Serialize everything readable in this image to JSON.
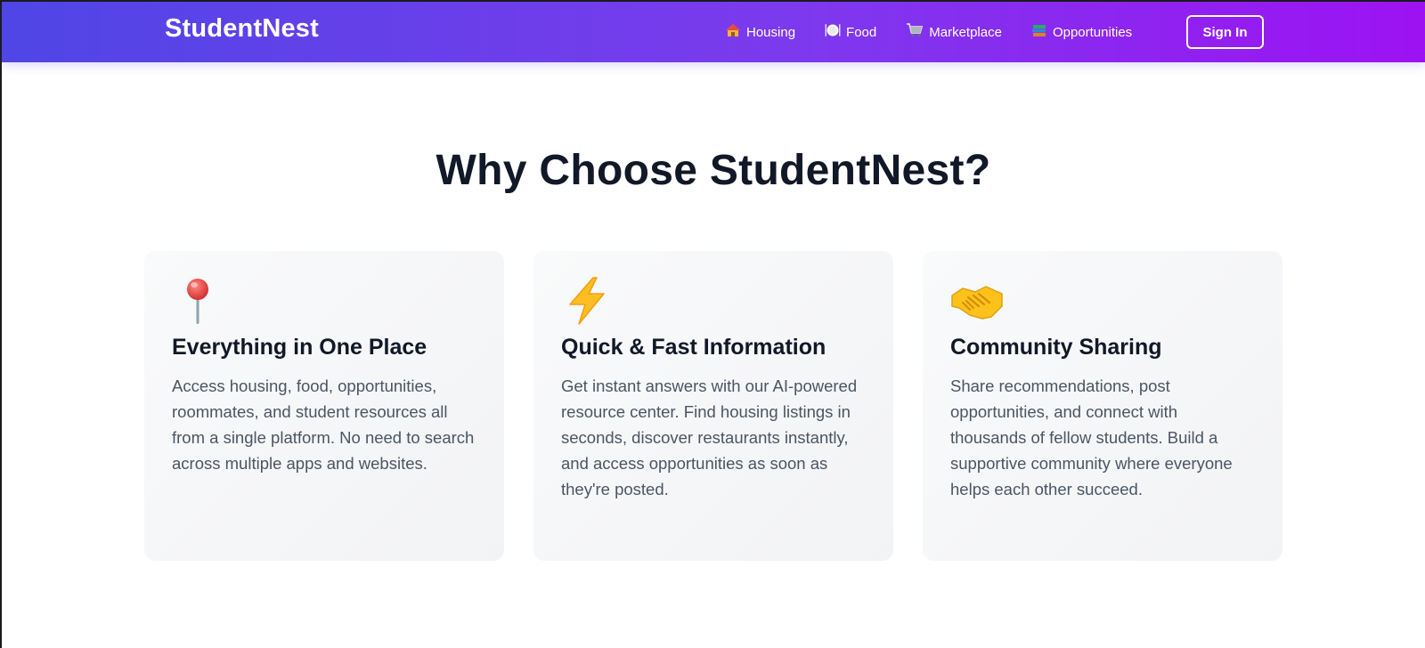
{
  "header": {
    "logo": "StudentNest",
    "nav": [
      {
        "label": "Housing",
        "icon": "house-icon"
      },
      {
        "label": "Food",
        "icon": "plate-icon"
      },
      {
        "label": "Marketplace",
        "icon": "cart-icon"
      },
      {
        "label": "Opportunities",
        "icon": "books-icon"
      }
    ],
    "signin_label": "Sign In"
  },
  "features": {
    "heading": "Why Choose StudentNest?",
    "cards": [
      {
        "icon": "pushpin-icon",
        "title": "Everything in One Place",
        "text": "Access housing, food, opportunities, roommates, and student resources all from a single platform. No need to search across multiple apps and websites."
      },
      {
        "icon": "lightning-icon",
        "title": "Quick & Fast Information",
        "text": "Get instant answers with our AI-powered resource center. Find housing listings in seconds, discover restaurants instantly, and access opportunities as soon as they're posted."
      },
      {
        "icon": "handshake-icon",
        "title": "Community Sharing",
        "text": "Share recommendations, post opportunities, and connect with thousands of fellow students. Build a supportive community where everyone helps each other succeed."
      }
    ]
  },
  "colors": {
    "header_gradient_start": "#4f46e5",
    "header_gradient_end": "#9d12f2",
    "heading": "#111827",
    "body_text": "#4b5563",
    "card_bg": "#f5f6f8"
  }
}
